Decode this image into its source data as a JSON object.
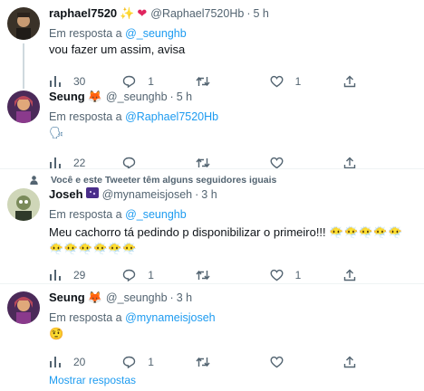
{
  "tweets": [
    {
      "name": "raphael7520",
      "name_emojis": "✨❤",
      "handle": "@Raphael7520Hb",
      "sep": "·",
      "time": "5 h",
      "reply_prefix": "Em resposta a",
      "reply_to": "@_seunghb",
      "text": "vou fazer um assim, avisa",
      "stats": {
        "replies": "",
        "retweets": "",
        "likes": "",
        "views": "30",
        "reply_count": "1",
        "like_count": "1"
      }
    },
    {
      "name": "Seung",
      "name_emojis": "🦊",
      "handle": "@_seunghb",
      "sep": "·",
      "time": "5 h",
      "reply_prefix": "Em resposta a",
      "reply_to": "@Raphael7520Hb",
      "text": "🗣",
      "stats": {
        "views": "22"
      }
    },
    {
      "name": "Joseh",
      "name_emojis": "🌌",
      "handle": "@mynameisjoseh",
      "sep": "·",
      "time": "3 h",
      "reply_prefix": "Em resposta a",
      "reply_to": "@_seunghb",
      "text": "Meu cachorro tá pedindo p disponibilizar o primeiro!!! 😶‍🌫️😶‍🌫️😶‍🌫️😶‍🌫️😶‍🌫️😶‍🌫️😶‍🌫️😶‍🌫️😶‍🌫️😶‍🌫️😶‍🌫️",
      "stats": {
        "views": "29",
        "reply_count": "1",
        "like_count": "1"
      }
    },
    {
      "name": "Seung",
      "name_emojis": "🦊",
      "handle": "@_seunghb",
      "sep": "·",
      "time": "3 h",
      "reply_prefix": "Em resposta a",
      "reply_to": "@mynameisjoseh",
      "text": "🤨",
      "stats": {
        "views": "20",
        "reply_count": "1"
      }
    }
  ],
  "social_context": "Você e este Tweeter têm alguns seguidores iguais",
  "show_more": "Mostrar respostas",
  "colors": {
    "link": "#1d9bf0",
    "muted": "#536471",
    "text": "#0f1419",
    "heart": "#e0245e"
  },
  "icons": [
    "views-icon",
    "reply-icon",
    "retweet-icon",
    "like-icon",
    "share-icon",
    "person-icon"
  ]
}
